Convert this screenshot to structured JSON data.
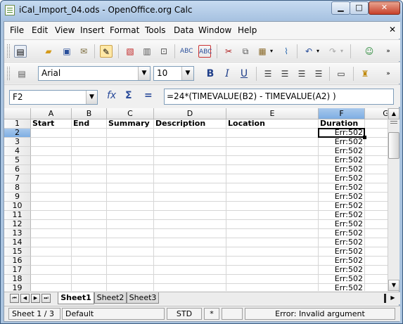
{
  "window": {
    "title": "iCal_Import_04.ods - OpenOffice.org Calc",
    "minimize_glyph": "▁",
    "maximize_glyph": "□",
    "close_glyph": "✕"
  },
  "menu": {
    "items": [
      "File",
      "Edit",
      "View",
      "Insert",
      "Format",
      "Tools",
      "Data",
      "Window",
      "Help"
    ],
    "close_doc_glyph": "✕"
  },
  "toolbar_standard": {
    "icons": [
      "new-document-icon",
      "open-folder-icon",
      "save-icon",
      "email-document-icon",
      "edit-file-icon",
      "export-pdf-icon",
      "print-icon",
      "page-preview-icon",
      "spellcheck-icon",
      "autospellcheck-icon",
      "cut-icon",
      "copy-icon",
      "paste-icon",
      "clone-formatting-icon",
      "undo-icon",
      "redo-icon",
      "navigator-icon"
    ]
  },
  "toolbar_format": {
    "font_name": "Arial",
    "font_size": "10",
    "bold": "B",
    "italic": "I",
    "underline": "U"
  },
  "formula_bar": {
    "name_box": "F2",
    "function_wizard_glyph": "fx",
    "sum_glyph": "Σ",
    "equals_glyph": "=",
    "formula": "=24*(TIMEVALUE(B2) - TIMEVALUE(A2) )"
  },
  "sheet": {
    "columns": [
      "A",
      "B",
      "C",
      "D",
      "E",
      "F",
      "G"
    ],
    "rows": [
      "1",
      "2",
      "3",
      "4",
      "5",
      "6",
      "7",
      "8",
      "9",
      "10",
      "11",
      "12",
      "13",
      "14",
      "15",
      "16",
      "17",
      "18",
      "19"
    ],
    "headers": {
      "A": "Start",
      "B": "End",
      "C": "Summary",
      "D": "Description",
      "E": "Location",
      "F": "Duration"
    },
    "error_value": "Err:502",
    "selected_cell": "F2",
    "selected_column": "F",
    "selected_row": "2"
  },
  "tabs": {
    "items": [
      "Sheet1",
      "Sheet2",
      "Sheet3"
    ],
    "active": "Sheet1"
  },
  "status": {
    "sheet": "Sheet 1 / 3",
    "page_style": "Default",
    "mode": "STD",
    "modified": "*",
    "message": "Error: Invalid argument"
  }
}
